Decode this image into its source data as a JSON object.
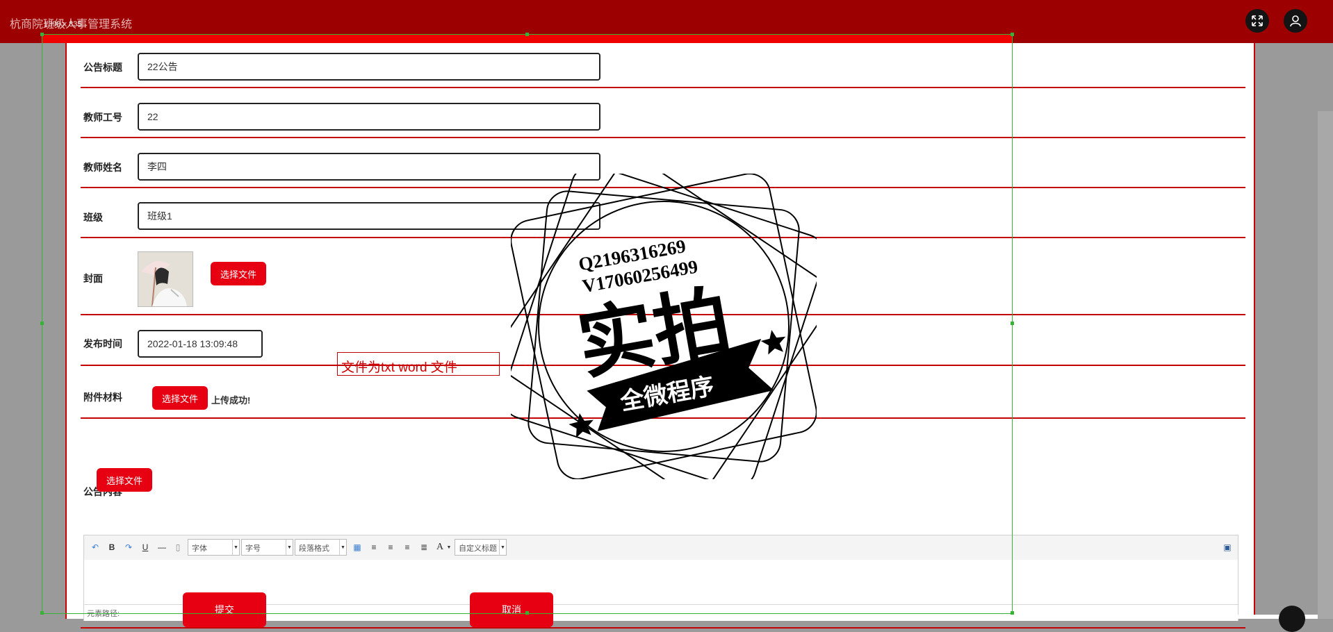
{
  "app": {
    "title": "杭商院班级人事管理系统",
    "dim_label": "1398 x 835"
  },
  "topbar": {
    "fullscreen_icon": "expand-arrows-icon",
    "user_icon": "user-avatar-icon"
  },
  "form": {
    "title": {
      "label": "公告标题",
      "value": "22公告"
    },
    "teacher_id": {
      "label": "教师工号",
      "value": "22"
    },
    "teacher_name": {
      "label": "教师姓名",
      "value": "李四"
    },
    "class": {
      "label": "班级",
      "value": "班级1"
    },
    "cover": {
      "label": "封面",
      "button": "选择文件"
    },
    "publish_time": {
      "label": "发布时间",
      "value": "2022-01-18 13:09:48"
    },
    "attachment": {
      "label": "附件材料",
      "button": "选择文件",
      "status": "上传成功!"
    },
    "content": {
      "label": "公告内容",
      "button": "选择文件"
    }
  },
  "editor": {
    "font_family": "字体",
    "font_size": "字号",
    "paragraph": "段落格式",
    "custom_title": "自定义标题",
    "path_label": "元素路径:"
  },
  "actions": {
    "submit": "提交",
    "cancel": "取消"
  },
  "overlay": {
    "note": "文件为txt  word  文件"
  },
  "watermark": {
    "contact_q": "Q2196316269",
    "contact_v": "V17060256499",
    "main": "实拍",
    "ribbon": "全微程序"
  },
  "colors": {
    "topbar": "#9c0000",
    "accent": "#e60012",
    "divider": "#c40000",
    "backdrop": "#9a9a9a"
  }
}
